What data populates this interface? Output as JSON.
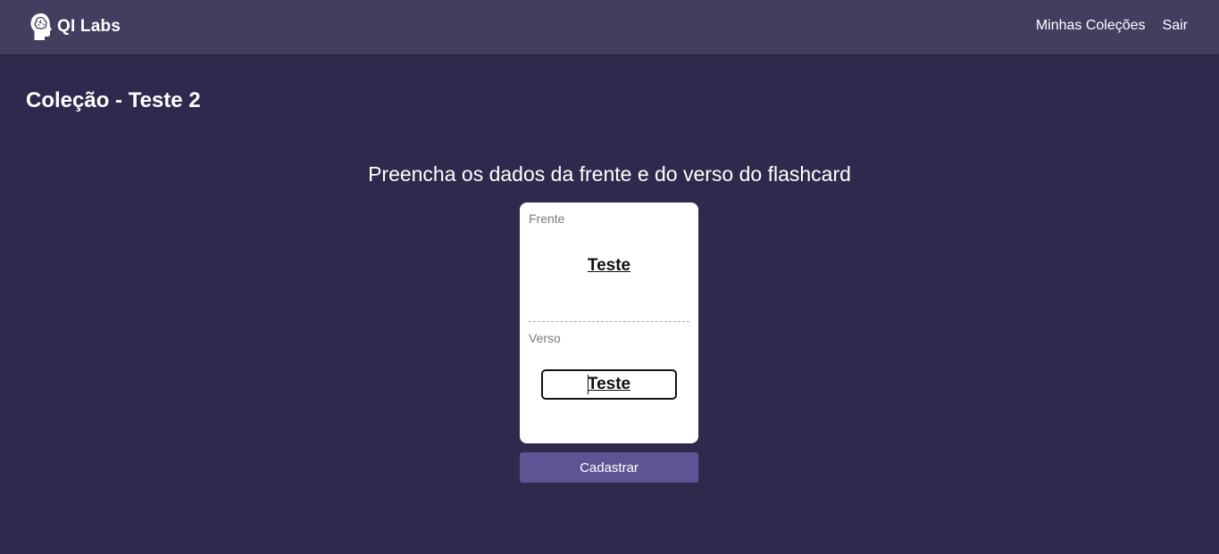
{
  "brand": {
    "name": "QI Labs",
    "icon": "brain-head-icon"
  },
  "nav": {
    "collections_label": "Minhas Coleções",
    "logout_label": "Sair"
  },
  "page": {
    "title": "Coleção - Teste 2"
  },
  "form": {
    "instructions": "Preencha os dados da frente e do verso do flashcard",
    "front": {
      "label": "Frente",
      "value": "Teste"
    },
    "back": {
      "label": "Verso",
      "value": "Teste"
    },
    "submit_label": "Cadastrar"
  },
  "colors": {
    "background": "#2e2a4d",
    "navbar": "#433e60",
    "button": "#5d5593",
    "card": "#ffffff"
  }
}
